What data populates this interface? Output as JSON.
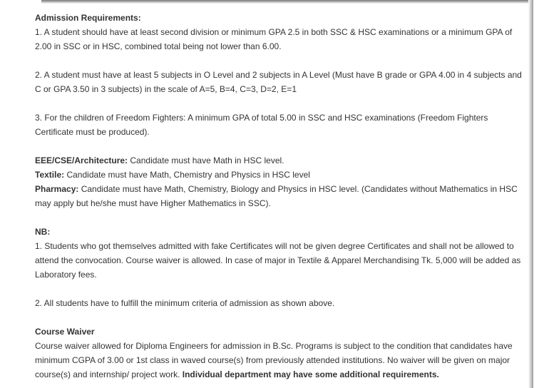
{
  "admission": {
    "heading": "Admission Requirements:",
    "item1": "1. A student should have at least second division or minimum GPA 2.5 in both SSC & HSC examinations or a minimum GPA of 2.00 in SSC or in HSC, combined total being not lower than 6.00.",
    "item2": "2. A student must have at least 5 subjects in O Level and 2 subjects in A Level (Must have B grade or GPA 4.00 in 4 subjects and C or GPA 3.50 in 3 subjects) in the scale of A=5, B=4, C=3, D=2, E=1",
    "item3": "3. For the children of Freedom Fighters: A minimum GPA of total 5.00 in SSC and HSC examinations (Freedom Fighters Certificate must be produced)."
  },
  "subjects": {
    "eee_label": "EEE/CSE/Architecture:",
    "eee_text": " Candidate must have Math in HSC level.",
    "textile_label": "Textile:",
    "textile_text": " Candidate must have Math, Chemistry and Physics in HSC level",
    "pharmacy_label": "Pharmacy:",
    "pharmacy_text": " Candidate must have Math, Chemistry, Biology and Physics in HSC level. (Candidates without Mathematics in HSC may apply but he/she must have Higher Mathematics in SSC)."
  },
  "nb": {
    "heading": "NB:",
    "item1": "1. Students who got themselves admitted with fake Certificates will not be given degree Certificates and shall not be allowed to attend the convocation. Course waiver is allowed. In case of major in Textile & Apparel Merchandising Tk. 5,000 will be added as Laboratory fees.",
    "item2": "2. All students have to fulfill the minimum criteria of admission as shown above."
  },
  "waiver": {
    "heading": "Course Waiver",
    "text": "Course waiver allowed for Diploma Engineers for admission in B.Sc. Programs is subject to the condition that candidates have minimum CGPA of 3.00 or 1st class in waved course(s) from previously attended institutions. No waiver will be given on major course(s) and internship/ project work. ",
    "bold_text": "Individual department may have some additional requirements."
  }
}
